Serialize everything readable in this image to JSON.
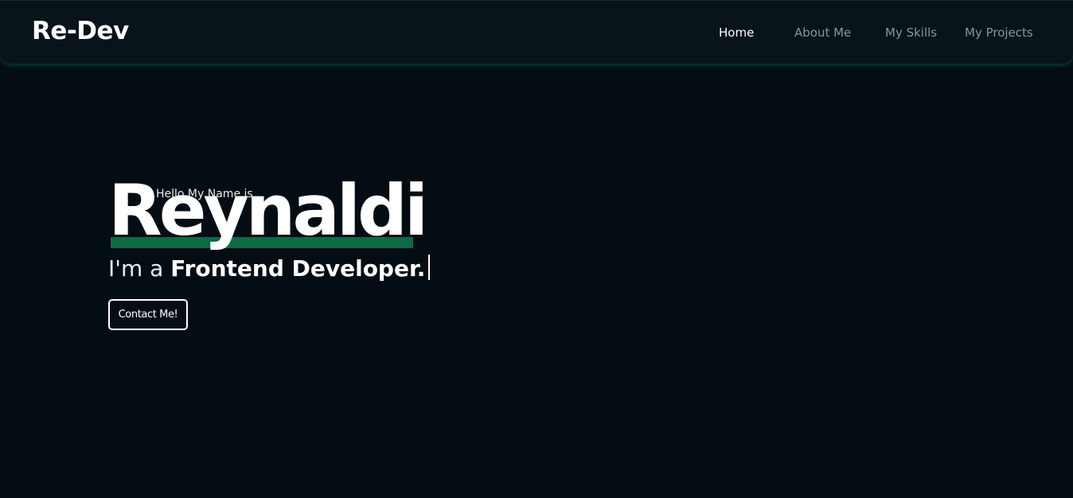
{
  "nav": {
    "logo": "Re-Dev",
    "links": [
      {
        "label": "Home",
        "active": true
      },
      {
        "label": "About Me",
        "active": false
      },
      {
        "label": "My Skills",
        "active": false
      },
      {
        "label": "My Projects",
        "active": false
      }
    ]
  },
  "hero": {
    "greeting": "Hello My Name is",
    "name": "Reynaldi",
    "role_prefix": "I'm a ",
    "role_title": "Frontend Developer.",
    "contact_label": "Contact Me!"
  },
  "colors": {
    "background": "#040d13",
    "navbar": "#08131a",
    "accent": "#0b6b43",
    "nav_inactive": "#8b959b",
    "text": "#ffffff"
  }
}
